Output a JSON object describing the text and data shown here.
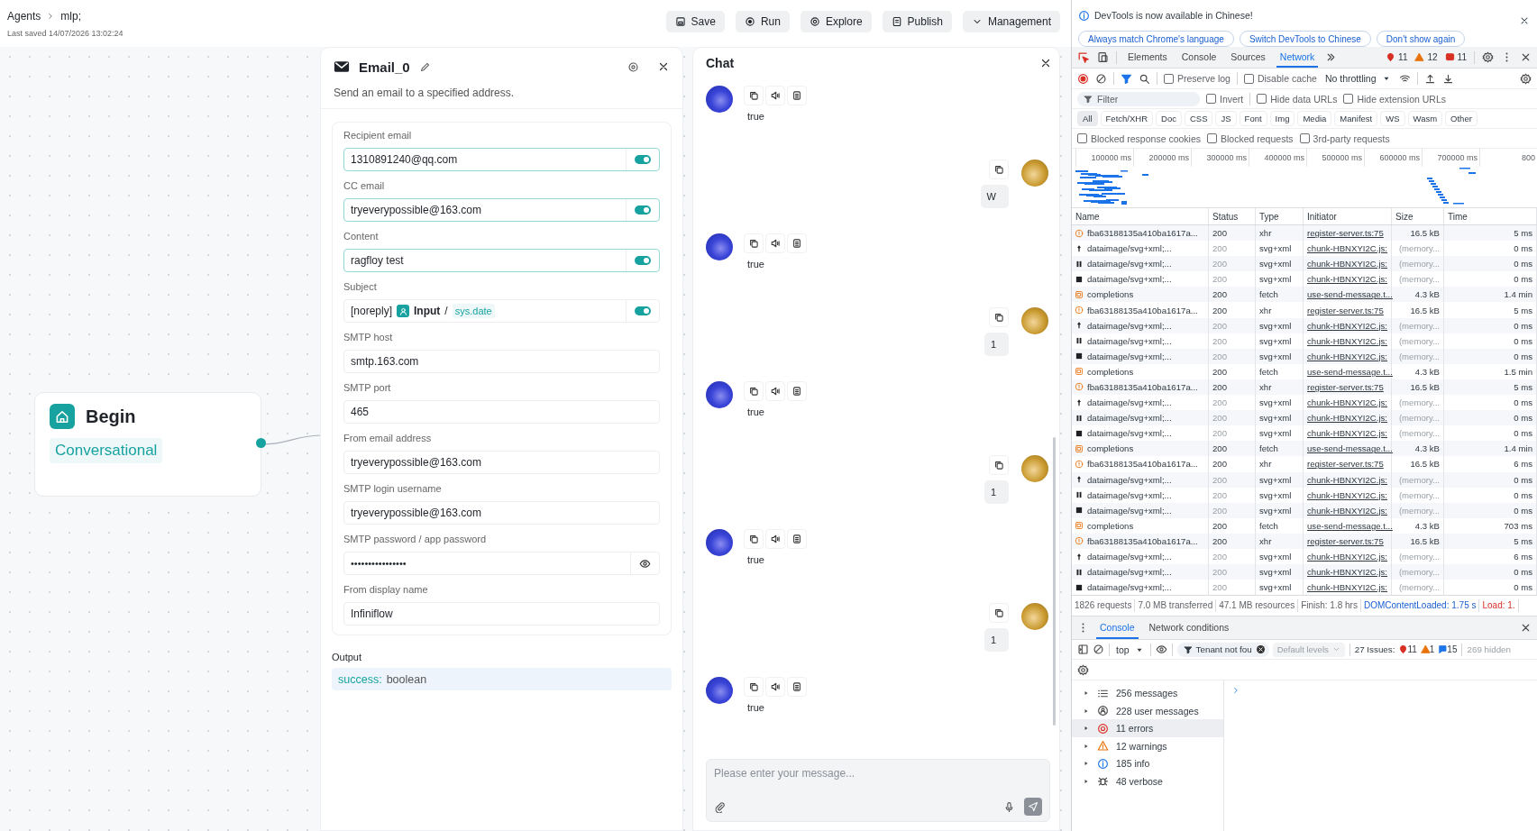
{
  "header": {
    "breadcrumb": [
      {
        "label": "Agents"
      },
      {
        "label": "mlp;"
      }
    ],
    "last_saved": "Last saved 14/07/2026 13:02:24",
    "buttons": [
      {
        "kind": "save",
        "label": "Save"
      },
      {
        "kind": "run",
        "label": "Run"
      },
      {
        "kind": "explore",
        "label": "Explore"
      },
      {
        "kind": "publish",
        "label": "Publish"
      },
      {
        "kind": "menu",
        "label": "Management"
      }
    ]
  },
  "canvas": {
    "node": {
      "title": "Begin",
      "mode": "Conversational"
    }
  },
  "email_panel": {
    "title": "Email_0",
    "description": "Send an email to a specified address.",
    "fields": [
      {
        "kind": "switch",
        "label": "Recipient email",
        "value": "1310891240@qq.com",
        "switch_on": true,
        "focused": true
      },
      {
        "kind": "switch",
        "label": "CC email",
        "value": "tryeverypossible@163.com",
        "switch_on": true,
        "focused": true
      },
      {
        "kind": "switch",
        "label": "Content",
        "value": "ragfloy test",
        "switch_on": true,
        "focused": true
      },
      {
        "kind": "reference",
        "label": "Subject",
        "prefix": "[noreply]",
        "node": "Input",
        "separator": "/",
        "variable": "sys.date",
        "switch_on": true,
        "focused": false
      },
      {
        "kind": "plain",
        "label": "SMTP host",
        "value": "smtp.163.com",
        "focused": false
      },
      {
        "kind": "plain",
        "label": "SMTP port",
        "value": "465",
        "focused": false
      },
      {
        "kind": "plain",
        "label": "From email address",
        "value": "tryeverypossible@163.com",
        "focused": false
      },
      {
        "kind": "plain",
        "label": "SMTP login username",
        "value": "tryeverypossible@163.com",
        "focused": false
      },
      {
        "kind": "password",
        "label": "SMTP password / app password",
        "value": "••••••••••••••••",
        "focused": false
      },
      {
        "kind": "plain",
        "label": "From display name",
        "value": "Infiniflow",
        "focused": false
      }
    ],
    "output": {
      "label": "Output",
      "name": "success:",
      "type": "boolean"
    }
  },
  "chat": {
    "title": "Chat",
    "messages": [
      {
        "kind": "bot",
        "text": "true"
      },
      {
        "kind": "user",
        "text": "W"
      },
      {
        "kind": "bot",
        "text": "true"
      },
      {
        "kind": "user",
        "text": "1"
      },
      {
        "kind": "bot",
        "text": "true"
      },
      {
        "kind": "user",
        "text": "1"
      },
      {
        "kind": "bot",
        "text": "true"
      },
      {
        "kind": "user",
        "text": "1"
      },
      {
        "kind": "bot",
        "text": "true"
      }
    ],
    "input": {
      "placeholder": "Please enter your message..."
    }
  },
  "devtools": {
    "banner": {
      "message": "DevTools is now available in Chinese!",
      "buttons": [
        "Always match Chrome's language",
        "Switch DevTools to Chinese",
        "Don't show again"
      ]
    },
    "tabs": [
      {
        "label": "Elements",
        "selected": false
      },
      {
        "label": "Console",
        "selected": false
      },
      {
        "label": "Sources",
        "selected": false
      },
      {
        "label": "Network",
        "selected": true
      }
    ],
    "counts": [
      {
        "kind": "error",
        "count": "11"
      },
      {
        "kind": "warning",
        "count": "12"
      },
      {
        "kind": "issue",
        "count": "11"
      }
    ],
    "toolbar": {
      "options": [
        {
          "label": "Preserve log",
          "checked": false
        },
        {
          "label": "Disable cache",
          "checked": false
        }
      ],
      "throttling": "No throttling"
    },
    "filter": {
      "placeholder": "Filter",
      "options": [
        {
          "label": "Invert",
          "checked": false
        },
        {
          "label": "Hide data URLs",
          "checked": false
        },
        {
          "label": "Hide extension URLs",
          "checked": false
        }
      ]
    },
    "types": [
      {
        "label": "All",
        "selected": true
      },
      {
        "label": "Fetch/XHR",
        "selected": false
      },
      {
        "label": "Doc",
        "selected": false
      },
      {
        "label": "CSS",
        "selected": false
      },
      {
        "label": "JS",
        "selected": false
      },
      {
        "label": "Font",
        "selected": false
      },
      {
        "label": "Img",
        "selected": false
      },
      {
        "label": "Media",
        "selected": false
      },
      {
        "label": "Manifest",
        "selected": false
      },
      {
        "label": "WS",
        "selected": false
      },
      {
        "label": "Wasm",
        "selected": false
      },
      {
        "label": "Other",
        "selected": false
      }
    ],
    "blocked_options": [
      {
        "label": "Blocked response cookies",
        "checked": false
      },
      {
        "label": "Blocked requests",
        "checked": false
      },
      {
        "label": "3rd-party requests",
        "checked": false
      }
    ],
    "overview_ticks": [
      "100000 ms",
      "200000 ms",
      "300000 ms",
      "400000 ms",
      "500000 ms",
      "600000 ms",
      "700000 ms",
      "800"
    ],
    "table": {
      "columns": [
        "Name",
        "Status",
        "Type",
        "Initiator",
        "Size",
        "Time"
      ],
      "rows": [
        {
          "kind": "xhr",
          "name": "fba63188135a410ba1617a...",
          "status": "200",
          "type": "xhr",
          "initiator": "register-server.ts:75",
          "size": "16.5 kB",
          "time": "5 ms"
        },
        {
          "kind": "pin",
          "name": "dataimage/svg+xml;...",
          "status": "200",
          "type": "svg+xml",
          "initiator": "chunk-HBNXYI2C.js:",
          "size": "(memory...",
          "time": "0 ms"
        },
        {
          "kind": "pause",
          "name": "dataimage/svg+xml;...",
          "status": "200",
          "type": "svg+xml",
          "initiator": "chunk-HBNXYI2C.js:",
          "size": "(memory...",
          "time": "0 ms"
        },
        {
          "kind": "square",
          "name": "dataimage/svg+xml;...",
          "status": "200",
          "type": "svg+xml",
          "initiator": "chunk-HBNXYI2C.js:",
          "size": "(memory...",
          "time": "0 ms"
        },
        {
          "kind": "fetch",
          "name": "completions",
          "status": "200",
          "type": "fetch",
          "initiator": "use-send-message.t...",
          "size": "4.3 kB",
          "time": "1.4 min"
        },
        {
          "kind": "xhr",
          "name": "fba63188135a410ba1617a...",
          "status": "200",
          "type": "xhr",
          "initiator": "register-server.ts:75",
          "size": "16.5 kB",
          "time": "5 ms"
        },
        {
          "kind": "pin",
          "name": "dataimage/svg+xml;...",
          "status": "200",
          "type": "svg+xml",
          "initiator": "chunk-HBNXYI2C.js:",
          "size": "(memory...",
          "time": "0 ms"
        },
        {
          "kind": "pause",
          "name": "dataimage/svg+xml;...",
          "status": "200",
          "type": "svg+xml",
          "initiator": "chunk-HBNXYI2C.js:",
          "size": "(memory...",
          "time": "0 ms"
        },
        {
          "kind": "square",
          "name": "dataimage/svg+xml;...",
          "status": "200",
          "type": "svg+xml",
          "initiator": "chunk-HBNXYI2C.js:",
          "size": "(memory...",
          "time": "0 ms"
        },
        {
          "kind": "fetch",
          "name": "completions",
          "status": "200",
          "type": "fetch",
          "initiator": "use-send-message.t...",
          "size": "4.3 kB",
          "time": "1.5 min"
        },
        {
          "kind": "xhr",
          "name": "fba63188135a410ba1617a...",
          "status": "200",
          "type": "xhr",
          "initiator": "register-server.ts:75",
          "size": "16.5 kB",
          "time": "5 ms"
        },
        {
          "kind": "pin",
          "name": "dataimage/svg+xml;...",
          "status": "200",
          "type": "svg+xml",
          "initiator": "chunk-HBNXYI2C.js:",
          "size": "(memory...",
          "time": "0 ms"
        },
        {
          "kind": "pause",
          "name": "dataimage/svg+xml;...",
          "status": "200",
          "type": "svg+xml",
          "initiator": "chunk-HBNXYI2C.js:",
          "size": "(memory...",
          "time": "0 ms"
        },
        {
          "kind": "square",
          "name": "dataimage/svg+xml;...",
          "status": "200",
          "type": "svg+xml",
          "initiator": "chunk-HBNXYI2C.js:",
          "size": "(memory...",
          "time": "0 ms"
        },
        {
          "kind": "fetch",
          "name": "completions",
          "status": "200",
          "type": "fetch",
          "initiator": "use-send-message.t...",
          "size": "4.3 kB",
          "time": "1.4 min"
        },
        {
          "kind": "xhr",
          "name": "fba63188135a410ba1617a...",
          "status": "200",
          "type": "xhr",
          "initiator": "register-server.ts:75",
          "size": "16.5 kB",
          "time": "6 ms"
        },
        {
          "kind": "pin",
          "name": "dataimage/svg+xml;...",
          "status": "200",
          "type": "svg+xml",
          "initiator": "chunk-HBNXYI2C.js:",
          "size": "(memory...",
          "time": "0 ms"
        },
        {
          "kind": "pause",
          "name": "dataimage/svg+xml;...",
          "status": "200",
          "type": "svg+xml",
          "initiator": "chunk-HBNXYI2C.js:",
          "size": "(memory...",
          "time": "0 ms"
        },
        {
          "kind": "square",
          "name": "dataimage/svg+xml;...",
          "status": "200",
          "type": "svg+xml",
          "initiator": "chunk-HBNXYI2C.js:",
          "size": "(memory...",
          "time": "0 ms"
        },
        {
          "kind": "fetch",
          "name": "completions",
          "status": "200",
          "type": "fetch",
          "initiator": "use-send-message.t...",
          "size": "4.3 kB",
          "time": "703 ms"
        },
        {
          "kind": "xhr",
          "name": "fba63188135a410ba1617a...",
          "status": "200",
          "type": "xhr",
          "initiator": "register-server.ts:75",
          "size": "16.5 kB",
          "time": "5 ms"
        },
        {
          "kind": "pin",
          "name": "dataimage/svg+xml;...",
          "status": "200",
          "type": "svg+xml",
          "initiator": "chunk-HBNXYI2C.js:",
          "size": "(memory...",
          "time": "6 ms"
        },
        {
          "kind": "pause",
          "name": "dataimage/svg+xml;...",
          "status": "200",
          "type": "svg+xml",
          "initiator": "chunk-HBNXYI2C.js:",
          "size": "(memory...",
          "time": "0 ms"
        },
        {
          "kind": "square",
          "name": "dataimage/svg+xml;...",
          "status": "200",
          "type": "svg+xml",
          "initiator": "chunk-HBNXYI2C.js:",
          "size": "(memory...",
          "time": "0 ms"
        }
      ]
    },
    "summary": [
      {
        "kind": "plain",
        "text": "1826 requests"
      },
      {
        "kind": "plain",
        "text": "7.0 MB transferred"
      },
      {
        "kind": "plain",
        "text": "47.1 MB resources"
      },
      {
        "kind": "plain",
        "text": "Finish: 1.8 hrs"
      },
      {
        "kind": "dom",
        "text": "DOMContentLoaded: 1.75 s"
      },
      {
        "kind": "load",
        "text": "Load: 1."
      }
    ],
    "drawer": {
      "tabs": [
        {
          "label": "Console",
          "selected": true
        },
        {
          "label": "Network conditions",
          "selected": false
        }
      ],
      "context": "top",
      "filter_chip": "Tenant not fou",
      "levels": "Default levels",
      "issues_label": "27 Issues:",
      "issue_counts": [
        {
          "kind": "error",
          "count": "11"
        },
        {
          "kind": "warning",
          "count": "1"
        },
        {
          "kind": "info",
          "count": "15"
        }
      ],
      "hidden": "269 hidden",
      "groups": [
        {
          "kind": "messages",
          "label": "256 messages",
          "selected": false
        },
        {
          "kind": "user",
          "label": "228 user messages",
          "selected": false
        },
        {
          "kind": "error",
          "label": "11 errors",
          "selected": true
        },
        {
          "kind": "warning",
          "label": "12 warnings",
          "selected": false
        },
        {
          "kind": "info",
          "label": "185 info",
          "selected": false
        },
        {
          "kind": "verbose",
          "label": "48 verbose",
          "selected": false
        }
      ]
    }
  }
}
